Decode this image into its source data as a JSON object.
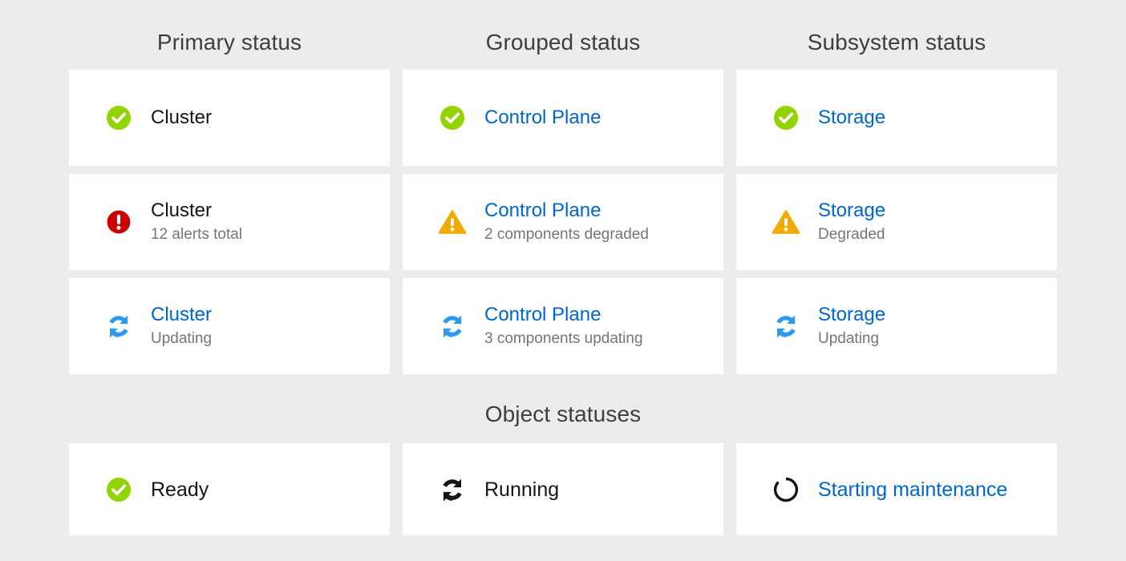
{
  "colors": {
    "background": "#ececec",
    "card": "#ffffff",
    "success": "#92d400",
    "danger": "#cc0000",
    "warning": "#f0ab00",
    "info": "#2b9af3",
    "link": "#0066cc",
    "text": "#151515",
    "subtext": "#72767b",
    "heading": "#3c3f42",
    "black": "#151515"
  },
  "sections": [
    {
      "id": "status-columns",
      "headings": [
        {
          "label": "Primary status",
          "name": "heading-primary-status"
        },
        {
          "label": "Grouped status",
          "name": "heading-grouped-status"
        },
        {
          "label": "Subsystem status",
          "name": "heading-subsystem-status"
        }
      ]
    },
    {
      "id": "object-statuses",
      "headings": [
        {
          "label": "Object statuses",
          "name": "heading-object-statuses"
        }
      ]
    }
  ],
  "cards": [
    {
      "icon": "check-circle-icon",
      "icon_color": "#92d400",
      "title": "Cluster",
      "title_link": false,
      "subtitle": ""
    },
    {
      "icon": "check-circle-icon",
      "icon_color": "#92d400",
      "title": "Control Plane",
      "title_link": true,
      "subtitle": ""
    },
    {
      "icon": "check-circle-icon",
      "icon_color": "#92d400",
      "title": "Storage",
      "title_link": true,
      "subtitle": ""
    },
    {
      "icon": "exclamation-circle-icon",
      "icon_color": "#cc0000",
      "title": "Cluster",
      "title_link": false,
      "subtitle": "12 alerts total"
    },
    {
      "icon": "exclamation-triangle-icon",
      "icon_color": "#f0ab00",
      "title": "Control Plane",
      "title_link": true,
      "subtitle": "2 components degraded"
    },
    {
      "icon": "exclamation-triangle-icon",
      "icon_color": "#f0ab00",
      "title": "Storage",
      "title_link": true,
      "subtitle": "Degraded"
    },
    {
      "icon": "sync-icon",
      "icon_color": "#2b9af3",
      "title": "Cluster",
      "title_link": true,
      "subtitle": "Updating"
    },
    {
      "icon": "sync-icon",
      "icon_color": "#2b9af3",
      "title": "Control Plane",
      "title_link": true,
      "subtitle": "3 components updating"
    },
    {
      "icon": "sync-icon",
      "icon_color": "#2b9af3",
      "title": "Storage",
      "title_link": true,
      "subtitle": "Updating"
    }
  ],
  "object_cards": [
    {
      "icon": "check-circle-icon",
      "icon_color": "#92d400",
      "title": "Ready",
      "title_link": false,
      "subtitle": ""
    },
    {
      "icon": "sync-icon",
      "icon_color": "#151515",
      "title": "Running",
      "title_link": false,
      "subtitle": ""
    },
    {
      "icon": "spinner-icon",
      "icon_color": "#151515",
      "title": "Starting maintenance",
      "title_link": true,
      "subtitle": ""
    }
  ]
}
